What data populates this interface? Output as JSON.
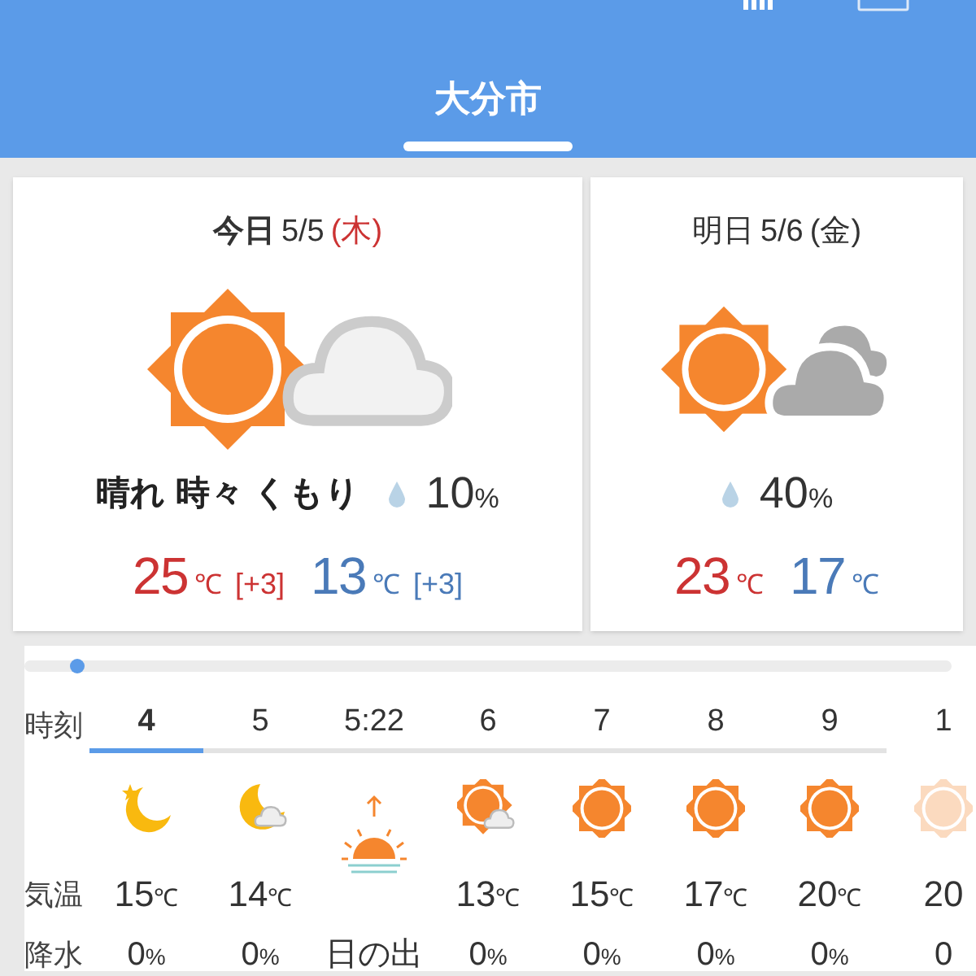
{
  "header": {
    "title": "大分市"
  },
  "days": [
    {
      "label": "今日",
      "date": "5/5",
      "weekday": "(木)",
      "holiday": true,
      "kind": "sun_cloud",
      "condition": "晴れ 時々 くもり",
      "precip": {
        "value": "10",
        "unit": "%"
      },
      "high": {
        "value": "25",
        "unit": "℃",
        "diff": "[+3]"
      },
      "low": {
        "value": "13",
        "unit": "℃",
        "diff": "[+3]"
      }
    },
    {
      "label": "明日",
      "date": "5/6",
      "weekday": "(金)",
      "holiday": false,
      "kind": "sun_dark_cloud",
      "precip": {
        "value": "40",
        "unit": "%"
      },
      "high": {
        "value": "23",
        "unit": "℃"
      },
      "low": {
        "value": "17",
        "unit": "℃"
      }
    }
  ],
  "hourly": {
    "row_labels": [
      "時刻",
      "気温",
      "降水"
    ],
    "columns": [
      {
        "time": "4",
        "selected": true,
        "kind": "moon_star",
        "temp": "15",
        "unit": "℃",
        "precip": "0",
        "precip_unit": "%"
      },
      {
        "time": "5",
        "selected": false,
        "kind": "moon_cloud",
        "temp": "14",
        "unit": "℃",
        "precip": "0",
        "precip_unit": "%"
      },
      {
        "time": "5:22",
        "selected": false,
        "kind": "sunrise",
        "event": "日の出"
      },
      {
        "time": "6",
        "selected": false,
        "kind": "sun_small_cloud",
        "temp": "13",
        "unit": "℃",
        "precip": "0",
        "precip_unit": "%"
      },
      {
        "time": "7",
        "selected": false,
        "kind": "sun",
        "temp": "15",
        "unit": "℃",
        "precip": "0",
        "precip_unit": "%"
      },
      {
        "time": "8",
        "selected": false,
        "kind": "sun",
        "temp": "17",
        "unit": "℃",
        "precip": "0",
        "precip_unit": "%"
      },
      {
        "time": "9",
        "selected": false,
        "kind": "sun",
        "temp": "20",
        "unit": "℃",
        "precip": "0",
        "precip_unit": "%"
      },
      {
        "time": "1",
        "selected": false,
        "kind": "sun",
        "temp": "20",
        "precip": "0"
      }
    ]
  }
}
